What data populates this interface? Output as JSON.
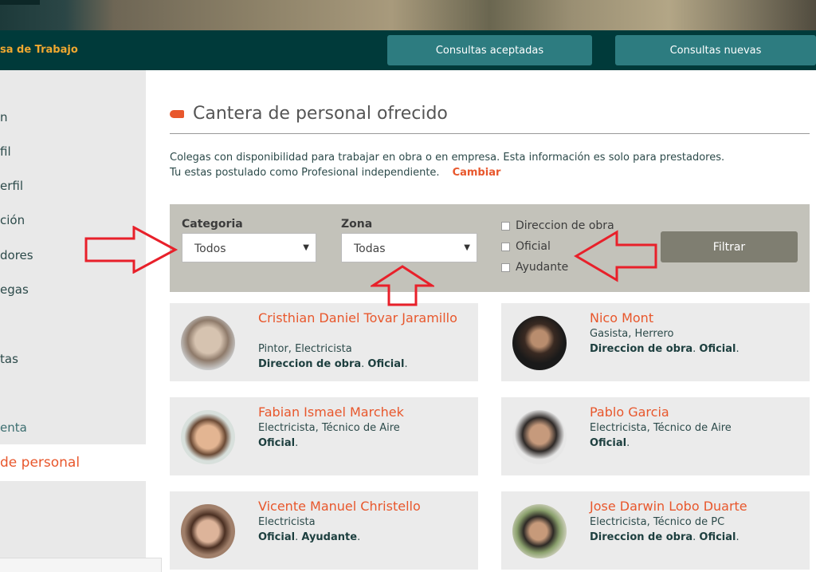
{
  "header": {
    "title": "sa de Trabajo",
    "buttons": [
      "Consultas aceptadas",
      "Consultas nuevas"
    ]
  },
  "sidebar": {
    "items": [
      "n",
      "fil",
      "erfil",
      "ción",
      "dores",
      "egas",
      "tas",
      "enta"
    ],
    "active": "de personal"
  },
  "page": {
    "title": "Cantera de personal ofrecido",
    "desc1": "Colegas con disponibilidad para trabajar en obra o en empresa. Esta información es solo para prestadores.",
    "desc2": "Tu estas postulado como Profesional independiente.",
    "change_link": "Cambiar"
  },
  "filters": {
    "category_label": "Categoria",
    "category_value": "Todos",
    "zone_label": "Zona",
    "zone_value": "Todas",
    "checkboxes": [
      "Direccion de obra",
      "Oficial",
      "Ayudante"
    ],
    "submit": "Filtrar"
  },
  "profiles": [
    {
      "name": "Cristhian Daniel Tovar Jaramillo",
      "trades": "Pintor, Electricista",
      "roles": [
        [
          "Direccion de obra",
          "."
        ],
        [
          "Oficial",
          "."
        ]
      ]
    },
    {
      "name": "Nico Mont",
      "trades": "Gasista, Herrero",
      "roles": [
        [
          "Direccion de obra",
          "."
        ],
        [
          "Oficial",
          "."
        ]
      ]
    },
    {
      "name": "Fabian Ismael Marchek",
      "trades": "Electricista, Técnico de Aire",
      "roles": [
        [
          "Oficial",
          "."
        ]
      ]
    },
    {
      "name": "Pablo Garcia",
      "trades": "Electricista, Técnico de Aire",
      "roles": [
        [
          "Oficial",
          "."
        ]
      ]
    },
    {
      "name": "Vicente Manuel Christello",
      "trades": "Electricista",
      "roles": [
        [
          "Oficial",
          "."
        ],
        [
          "Ayudante",
          "."
        ]
      ]
    },
    {
      "name": "Jose Darwin Lobo Duarte",
      "trades": "Electricista, Técnico de PC",
      "roles": [
        [
          "Direccion de obra",
          "."
        ],
        [
          "Oficial",
          "."
        ]
      ]
    }
  ],
  "colors": {
    "accent": "#e8572c",
    "navbar": "#003a3a",
    "nav_button": "#2d7c80",
    "annotation_arrow": "#e8202a"
  }
}
